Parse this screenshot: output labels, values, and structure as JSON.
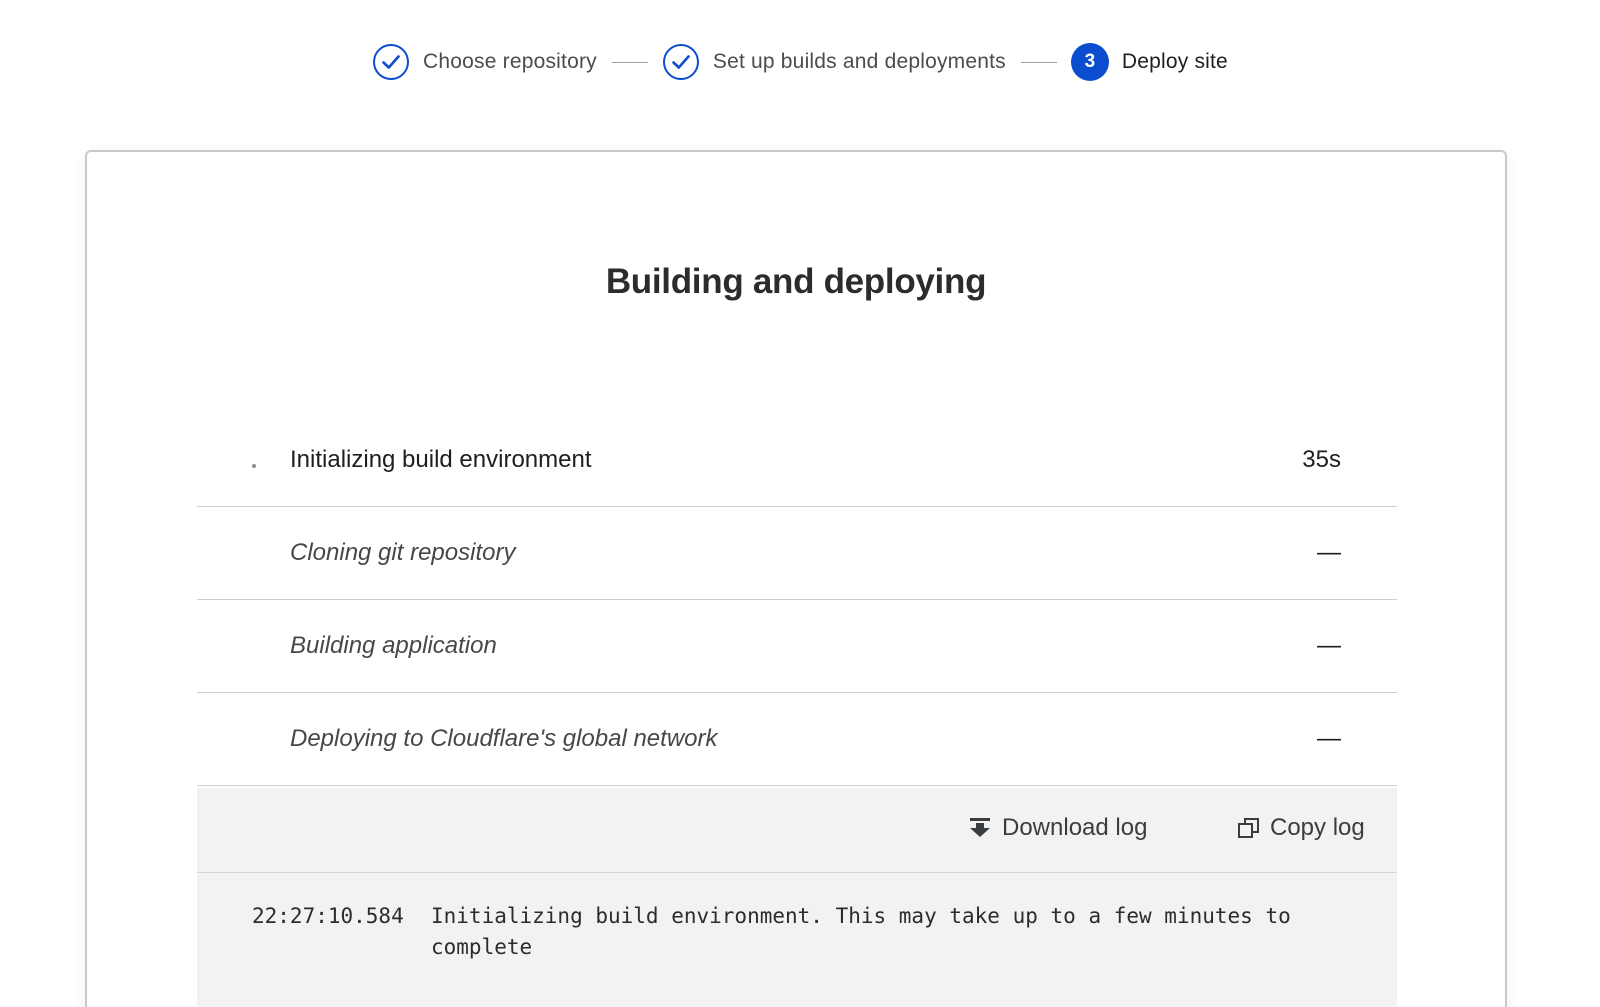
{
  "stepper": {
    "steps": [
      {
        "label": "Choose repository",
        "status": "complete"
      },
      {
        "label": "Set up builds and deployments",
        "status": "complete"
      },
      {
        "number": "3",
        "label": "Deploy site",
        "status": "active"
      }
    ]
  },
  "card": {
    "title": "Building and deploying",
    "build_steps": [
      {
        "label": "Initializing build environment",
        "duration": "35s",
        "state": "current"
      },
      {
        "label": "Cloning git repository",
        "duration": "—",
        "state": "pending"
      },
      {
        "label": "Building application",
        "duration": "—",
        "state": "pending"
      },
      {
        "label": "Deploying to Cloudflare's global network",
        "duration": "—",
        "state": "pending"
      }
    ]
  },
  "log": {
    "download_label": "Download log",
    "copy_label": "Copy log",
    "download_icon": "download-icon",
    "copy_icon": "copy-icon",
    "lines": [
      {
        "time": "22:27:10.584",
        "message": "Initializing build environment. This may take up to a few minutes to complete"
      }
    ]
  },
  "colors": {
    "accent": "#0b4dce",
    "log_background": "#f2f2f2",
    "divider": "#cfcfcf"
  }
}
